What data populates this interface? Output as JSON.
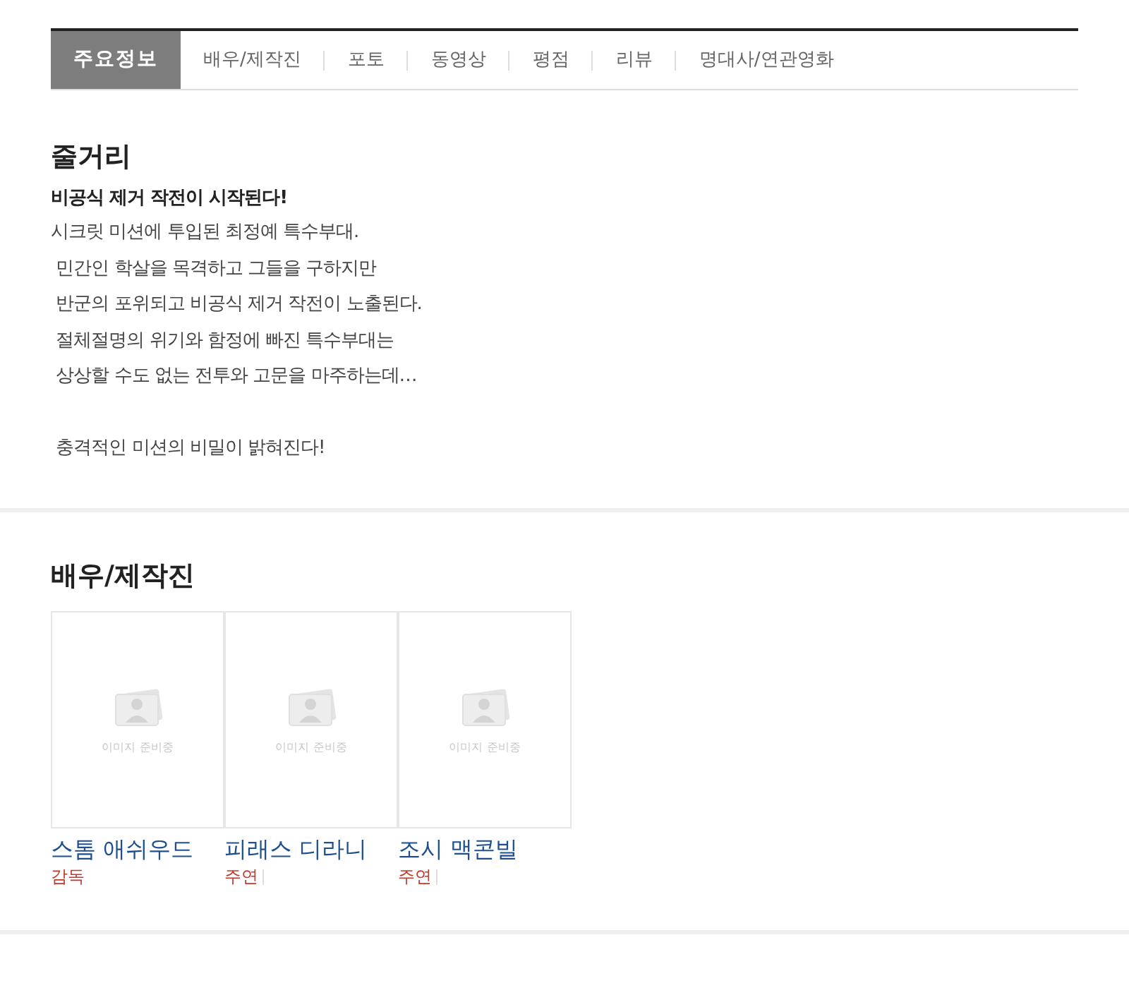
{
  "tabs": [
    {
      "label": "주요정보",
      "selected": true
    },
    {
      "label": "배우/제작진",
      "selected": false
    },
    {
      "label": "포토",
      "selected": false
    },
    {
      "label": "동영상",
      "selected": false
    },
    {
      "label": "평점",
      "selected": false
    },
    {
      "label": "리뷰",
      "selected": false
    },
    {
      "label": "명대사/연관영화",
      "selected": false
    }
  ],
  "synopsis": {
    "heading": "줄거리",
    "tagline": "비공식 제거 작전이 시작된다!",
    "lines": [
      {
        "text": "시크릿 미션에 투입된 최정예 특수부대.",
        "blank_line_before": false
      },
      {
        "text": " 민간인 학살을 목격하고 그들을 구하지만",
        "blank_line_before": false
      },
      {
        "text": " 반군의 포위되고 비공식 제거 작전이 노출된다.",
        "blank_line_before": false
      },
      {
        "text": " 절체절명의 위기와 함정에 빠진 특수부대는",
        "blank_line_before": false
      },
      {
        "text": " 상상할 수도 없는 전투와 고문을 마주하는데…",
        "blank_line_before": false
      },
      {
        "text": " 충격적인 미션의 비밀이 밝혀진다!",
        "blank_line_before": true
      }
    ]
  },
  "cast": {
    "heading": "배우/제작진",
    "people": [
      {
        "photo_caption": "이미지 준비중",
        "name": "스톰 애쉬우드",
        "role": "감독",
        "role_separator": false
      },
      {
        "photo_caption": "이미지 준비중",
        "name": "피래스 디라니",
        "role": "주연",
        "role_separator": true
      },
      {
        "photo_caption": "이미지 준비중",
        "name": "조시 맥콘빌",
        "role": "주연",
        "role_separator": true
      }
    ]
  }
}
